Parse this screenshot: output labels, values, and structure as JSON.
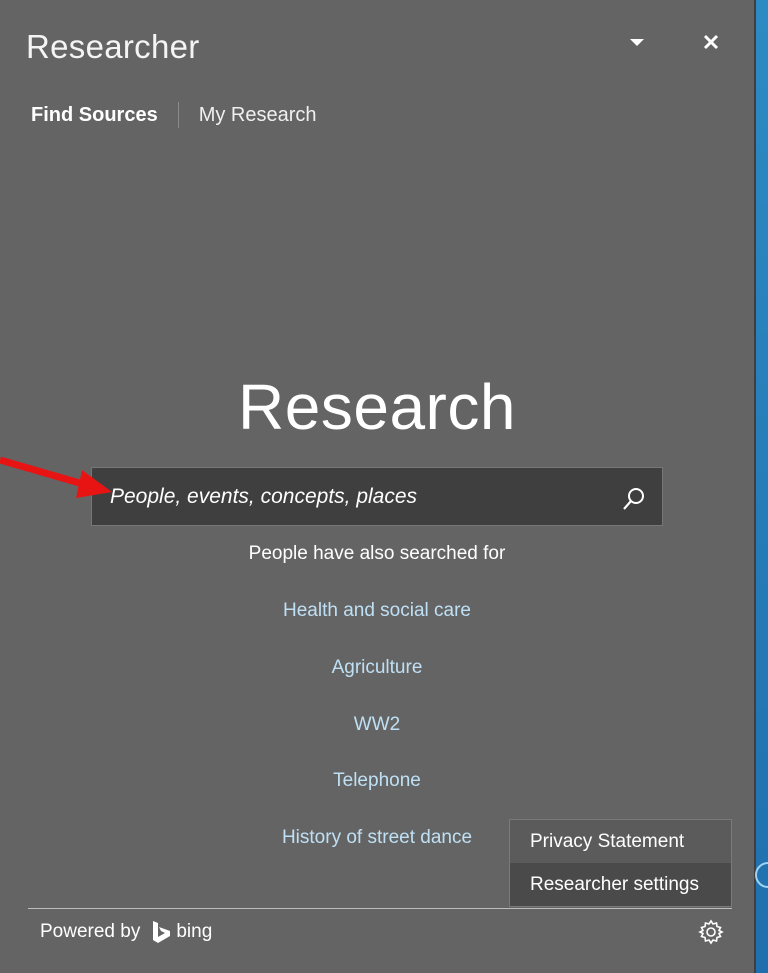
{
  "window": {
    "title": "Researcher"
  },
  "tabs": [
    {
      "label": "Find Sources",
      "active": true
    },
    {
      "label": "My Research",
      "active": false
    }
  ],
  "hero_title": "Research",
  "search": {
    "placeholder": "People, events, concepts, places",
    "value": ""
  },
  "suggestions": {
    "heading": "People have also searched for",
    "items": [
      "Health and social care",
      "Agriculture",
      "WW2",
      "Telephone",
      "History of street dance"
    ]
  },
  "context_menu": {
    "items": [
      "Privacy Statement",
      "Researcher settings"
    ]
  },
  "footer": {
    "powered_by": "Powered by",
    "brand": "bing"
  },
  "icons": {
    "dropdown": "chevron-down-icon",
    "close": "close-icon",
    "search": "search-icon",
    "settings": "gear-icon",
    "brand_logo": "bing-logo-icon"
  },
  "colors": {
    "pane_background": "#646464",
    "link": "#bfe0f4",
    "search_background": "#3f3f3f",
    "annotation_arrow": "#e81414"
  }
}
